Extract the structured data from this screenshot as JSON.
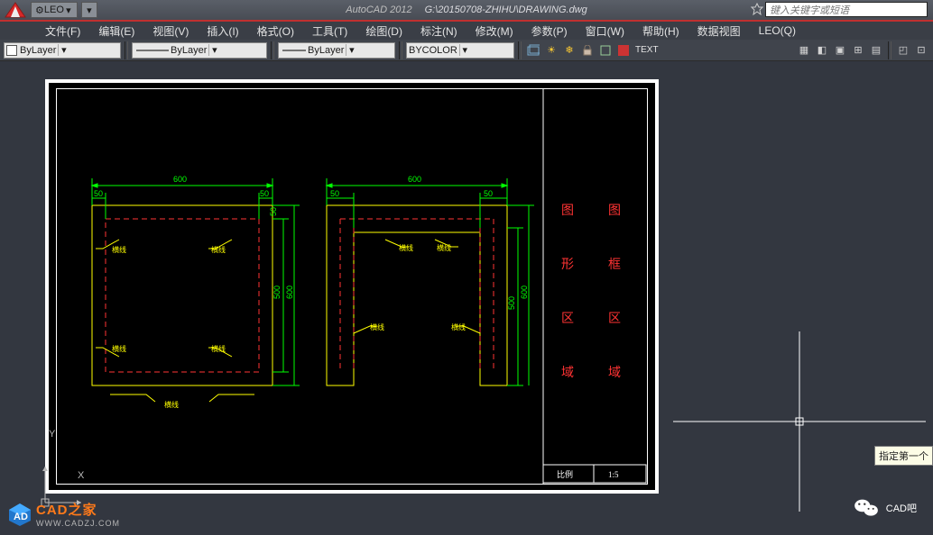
{
  "title": {
    "app": "AutoCAD 2012",
    "path": "G:\\20150708-ZHIHU\\DRAWING.dwg"
  },
  "qat": {
    "workspace": "LEO"
  },
  "search": {
    "placeholder": "键入关键字或短语"
  },
  "menu": {
    "file": "文件(F)",
    "edit": "编辑(E)",
    "view": "视图(V)",
    "insert": "插入(I)",
    "format": "格式(O)",
    "tools": "工具(T)",
    "draw": "绘图(D)",
    "dimension": "标注(N)",
    "modify": "修改(M)",
    "param": "参数(P)",
    "window": "窗口(W)",
    "help": "帮助(H)",
    "dataview": "数据视图",
    "leo": "LEO(Q)"
  },
  "props": {
    "layer": "ByLayer",
    "linetype": "ByLayer",
    "lineweight": "ByLayer",
    "color": "BYCOLOR",
    "text_tool": "TEXT"
  },
  "drawing": {
    "dims": {
      "outer": "600",
      "side": "50",
      "inner_h": "500",
      "outer_h": "600",
      "inner2": "500",
      "outer2": "600"
    },
    "labels": [
      "横线",
      "横线",
      "横线",
      "横线",
      "横线",
      "横线",
      "横线",
      "横线",
      "横线",
      "横线"
    ],
    "red_left": [
      "图",
      "形",
      "区",
      "域"
    ],
    "red_right": [
      "图",
      "框",
      "区",
      "域"
    ],
    "scale": "1:5",
    "block_lbl": "比例"
  },
  "ucs": {
    "x": "X",
    "y": "Y"
  },
  "tooltip": "指定第一个",
  "watermark": {
    "left_text": "CAD之家",
    "left_url": "WWW.CADZJ.COM",
    "right_text": "CAD吧"
  }
}
